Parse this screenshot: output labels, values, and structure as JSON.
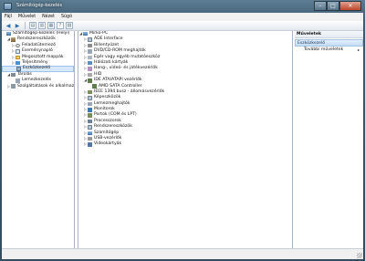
{
  "window": {
    "title": "Számítógép-kezelés"
  },
  "caption": {
    "min": "–",
    "max": "□",
    "close": "✕"
  },
  "menu": [
    "Fájl",
    "Művelet",
    "Nézet",
    "Súgó"
  ],
  "left_tree": [
    {
      "label": "Számítógép-kezelés (Helyi)",
      "icon": "computer",
      "level": 0,
      "arrow": ""
    },
    {
      "label": "Rendszereszközök",
      "icon": "tool",
      "level": 1,
      "arrow": "◢"
    },
    {
      "label": "Feladatütemező",
      "icon": "clock",
      "level": 2,
      "arrow": "▷"
    },
    {
      "label": "Eseménynapló",
      "icon": "log",
      "level": 2,
      "arrow": "▷"
    },
    {
      "label": "Megosztott mappák",
      "icon": "folder",
      "level": 2,
      "arrow": "▷"
    },
    {
      "label": "Teljesítmény",
      "icon": "perf",
      "level": 2,
      "arrow": "▷"
    },
    {
      "label": "Eszközkezelő",
      "icon": "dev",
      "level": 2,
      "arrow": "",
      "selected": true
    },
    {
      "label": "Tárolás",
      "icon": "storage",
      "level": 1,
      "arrow": "◢"
    },
    {
      "label": "Lemezkezelés",
      "icon": "disk",
      "level": 2,
      "arrow": ""
    },
    {
      "label": "Szolgáltatások és alkalmazások",
      "icon": "svc",
      "level": 1,
      "arrow": "▷"
    }
  ],
  "device_tree": [
    {
      "label": "Mirko-PC",
      "icon": "computer",
      "level": 0,
      "arrow": "◢"
    },
    {
      "label": "ADE Interface",
      "icon": "generic",
      "level": 1,
      "arrow": "▷"
    },
    {
      "label": "Billentyűzet",
      "icon": "kbd",
      "level": 1,
      "arrow": "▷"
    },
    {
      "label": "DVD/CD-ROM meghajtók",
      "icon": "disk",
      "level": 1,
      "arrow": "▷"
    },
    {
      "label": "Egér vagy egyéb mutatóeszköz",
      "icon": "mouse",
      "level": 1,
      "arrow": "▷"
    },
    {
      "label": "Hálózati kártyák",
      "icon": "net",
      "level": 1,
      "arrow": "▷"
    },
    {
      "label": "Hang-, videó- és játékvezérlők",
      "icon": "speaker",
      "level": 1,
      "arrow": "▷"
    },
    {
      "label": "HID",
      "icon": "hid",
      "level": 1,
      "arrow": "▷"
    },
    {
      "label": "IDE ATA/ATAPI vezérlők",
      "icon": "chip",
      "level": 1,
      "arrow": "◢"
    },
    {
      "label": "AMD SATA Controller",
      "icon": "chip",
      "level": 2,
      "arrow": ""
    },
    {
      "label": "IEEE 1394 busz - állomásvezérlők",
      "icon": "port",
      "level": 1,
      "arrow": "▷"
    },
    {
      "label": "Képeszközök",
      "icon": "generic",
      "level": 1,
      "arrow": "▷"
    },
    {
      "label": "Lemezmeghajtók",
      "icon": "disk",
      "level": 1,
      "arrow": "▷"
    },
    {
      "label": "Monitorok",
      "icon": "monitor",
      "level": 1,
      "arrow": "▷"
    },
    {
      "label": "Portok (COM és LPT)",
      "icon": "port",
      "level": 1,
      "arrow": "▷"
    },
    {
      "label": "Processzorok",
      "icon": "cpu",
      "level": 1,
      "arrow": "▷"
    },
    {
      "label": "Rendszereszközök",
      "icon": "generic",
      "level": 1,
      "arrow": "▷"
    },
    {
      "label": "Számítógép",
      "icon": "computer",
      "level": 1,
      "arrow": "▷"
    },
    {
      "label": "USB-vezérlők",
      "icon": "usb",
      "level": 1,
      "arrow": "▷"
    },
    {
      "label": "Videokártyák",
      "icon": "video",
      "level": 1,
      "arrow": "▷"
    }
  ],
  "actions": {
    "header": "Műveletek",
    "section": "Eszközkezelő",
    "items": [
      {
        "label": "További műveletek",
        "chevron": "▸"
      }
    ]
  }
}
